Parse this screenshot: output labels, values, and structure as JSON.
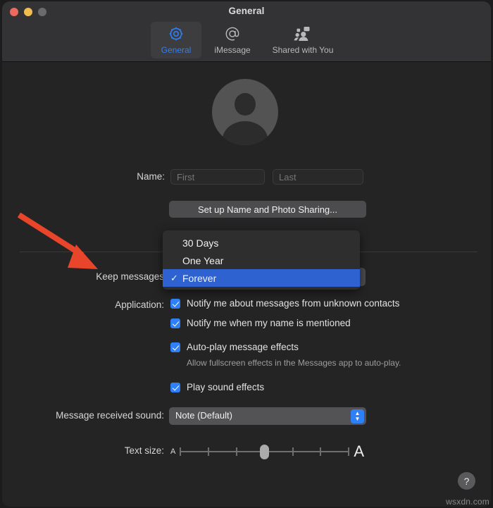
{
  "window": {
    "title": "General",
    "traffic_lights": [
      {
        "name": "close",
        "color": "#ED6B5E"
      },
      {
        "name": "minimize",
        "color": "#F1BD4F"
      },
      {
        "name": "zoom",
        "color": "#6B6B6B"
      }
    ]
  },
  "toolbar": {
    "tabs": [
      {
        "label": "General",
        "icon": "gear-icon",
        "selected": true
      },
      {
        "label": "iMessage",
        "icon": "at-sign-icon",
        "selected": false
      },
      {
        "label": "Shared with You",
        "icon": "people-icon",
        "selected": false
      }
    ],
    "accent_color": "#2F7FF6"
  },
  "profile": {
    "avatar_icon": "person-placeholder-icon",
    "name_label": "Name:",
    "first_placeholder": "First",
    "first_value": "",
    "last_placeholder": "Last",
    "last_value": "",
    "setup_button": "Set up Name and Photo Sharing..."
  },
  "keep_messages": {
    "label": "Keep messages",
    "selected": "Forever",
    "options": [
      {
        "label": "30 Days",
        "checked": false
      },
      {
        "label": "One Year",
        "checked": false
      },
      {
        "label": "Forever",
        "checked": true
      }
    ],
    "checkmark": "✓",
    "highlight_color": "#2D62D0"
  },
  "application": {
    "label": "Application:",
    "checkboxes": [
      {
        "label": "Notify me about messages from unknown contacts",
        "checked": true
      },
      {
        "label": "Notify me when my name is mentioned",
        "checked": true
      },
      {
        "label": "Auto-play message effects",
        "checked": true
      },
      {
        "label": "Play sound effects",
        "checked": true
      }
    ],
    "auto_play_help": "Allow fullscreen effects in the Messages app to auto-play."
  },
  "sound": {
    "label": "Message received sound:",
    "value": "Note (Default)",
    "stepper_up": "▲",
    "stepper_down": "▼"
  },
  "text_size": {
    "label": "Text size:",
    "min_glyph": "A",
    "max_glyph": "A",
    "ticks": 7,
    "value": 3,
    "max": 6
  },
  "help": {
    "label": "?"
  },
  "annotation": {
    "arrow_color": "#E8452B",
    "points_at": "Keep messages"
  },
  "watermark": "wsxdn.com"
}
